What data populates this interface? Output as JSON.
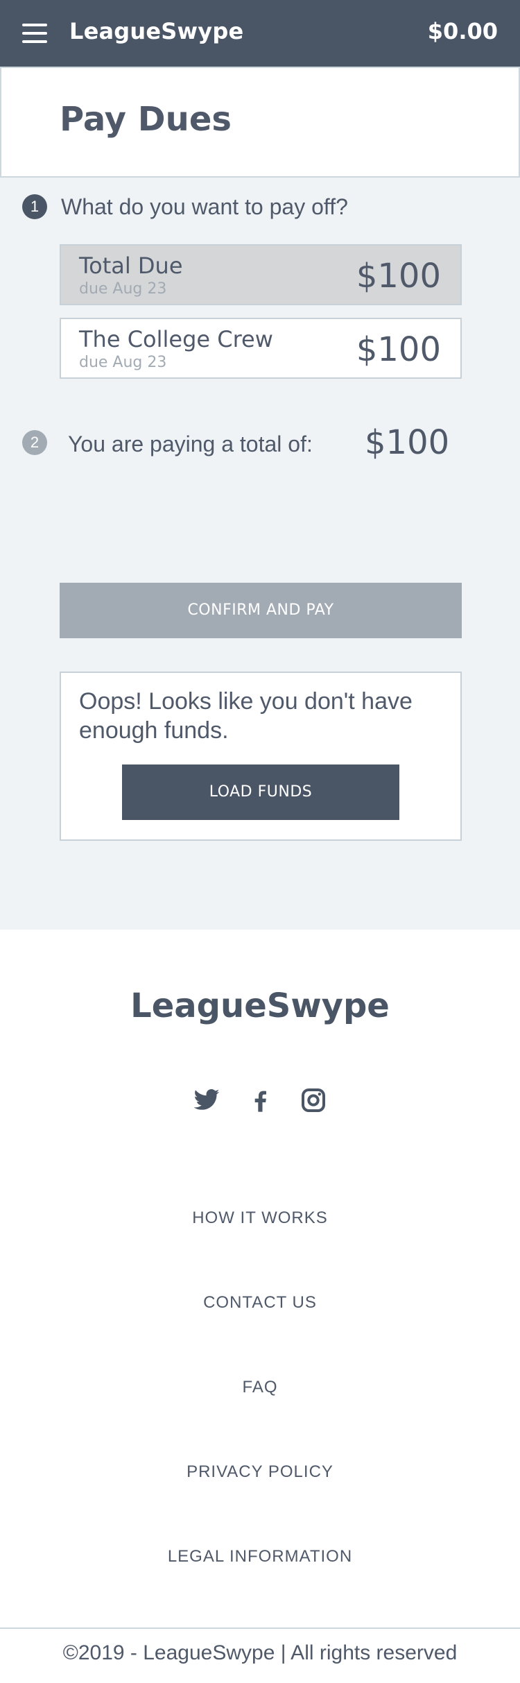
{
  "header": {
    "brand": "LeagueSwype",
    "balance": "$0.00"
  },
  "page": {
    "title": "Pay Dues"
  },
  "step1": {
    "number": "1",
    "question": "What do you want to pay off?",
    "options": [
      {
        "title": "Total Due",
        "due": "due Aug 23",
        "amount": "$100",
        "selected": true
      },
      {
        "title": "The College Crew",
        "due": "due Aug 23",
        "amount": "$100",
        "selected": false
      }
    ]
  },
  "step2": {
    "number": "2",
    "text": "You are paying a total of:",
    "amount": "$100"
  },
  "confirm_label": "CONFIRM AND PAY",
  "alert": {
    "message": "Oops! Looks like you don't have enough funds.",
    "button_label": "LOAD FUNDS"
  },
  "footer": {
    "brand": "LeagueSwype",
    "social_icons": [
      "twitter-icon",
      "facebook-icon",
      "instagram-icon"
    ],
    "links": [
      "HOW IT WORKS",
      "CONTACT US",
      "FAQ",
      "PRIVACY POLICY",
      "LEGAL INFORMATION"
    ],
    "copyright": "©2019 - LeagueSwype | All rights reserved"
  },
  "colors": {
    "header_bg": "#4a5566",
    "page_bg": "#f0f3f6",
    "disabled_button": "#a2abb3",
    "selected_option": "#d4d6d8"
  }
}
